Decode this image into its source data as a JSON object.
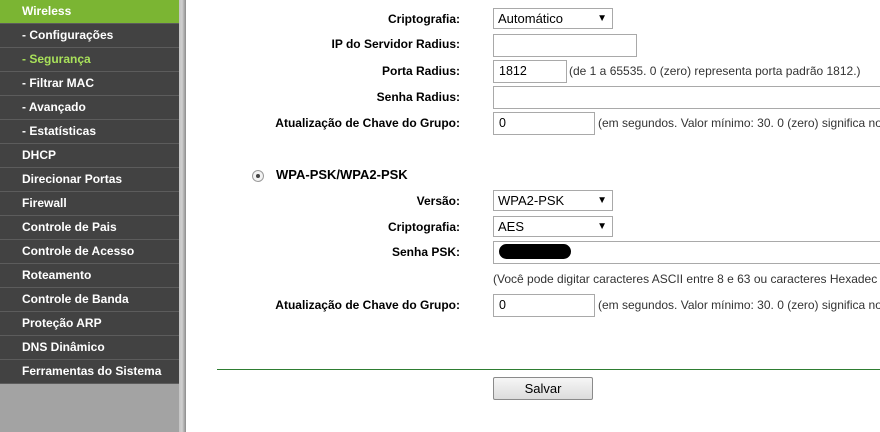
{
  "sidebar": {
    "items": [
      {
        "label": "Wireless",
        "state": "active-parent",
        "sub": false
      },
      {
        "label": "- Configurações",
        "state": "",
        "sub": true
      },
      {
        "label": "- Segurança",
        "state": "active",
        "sub": true
      },
      {
        "label": "- Filtrar MAC",
        "state": "",
        "sub": true
      },
      {
        "label": "- Avançado",
        "state": "",
        "sub": true
      },
      {
        "label": "- Estatísticas",
        "state": "",
        "sub": true
      },
      {
        "label": "DHCP",
        "state": "",
        "sub": false
      },
      {
        "label": "Direcionar Portas",
        "state": "",
        "sub": false
      },
      {
        "label": "Firewall",
        "state": "",
        "sub": false
      },
      {
        "label": "Controle de Pais",
        "state": "",
        "sub": false
      },
      {
        "label": "Controle de Acesso",
        "state": "",
        "sub": false
      },
      {
        "label": "Roteamento",
        "state": "",
        "sub": false
      },
      {
        "label": "Controle de Banda",
        "state": "",
        "sub": false
      },
      {
        "label": "Proteção ARP",
        "state": "",
        "sub": false
      },
      {
        "label": "DNS Dinâmico",
        "state": "",
        "sub": false
      },
      {
        "label": "Ferramentas do Sistema",
        "state": "",
        "sub": false
      }
    ]
  },
  "wpa_enterprise": {
    "crypto_label": "Criptografia:",
    "crypto_value": "Automático",
    "radius_ip_label": "IP do Servidor Radius:",
    "radius_ip_value": "",
    "radius_port_label": "Porta Radius:",
    "radius_port_value": "1812",
    "radius_port_hint": "(de 1 a 65535. 0 (zero) representa porta padrão 1812.)",
    "radius_password_label": "Senha Radius:",
    "radius_password_value": "",
    "group_key_label": "Atualização de Chave do Grupo:",
    "group_key_value": "0",
    "group_key_hint": "(em segundos. Valor mínimo: 30. 0 (zero) significa no"
  },
  "wpa_psk": {
    "title": "WPA-PSK/WPA2-PSK",
    "selected": true,
    "version_label": "Versão:",
    "version_value": "WPA2-PSK",
    "crypto_label": "Criptografia:",
    "crypto_value": "AES",
    "psk_label": "Senha PSK:",
    "psk_hint": "(Você pode digitar caracteres ASCII entre 8 e 63 ou caracteres Hexadec",
    "group_key_label": "Atualização de Chave do Grupo:",
    "group_key_value": "0",
    "group_key_hint": "(em segundos. Valor mínimo: 30. 0 (zero) significa no"
  },
  "footer": {
    "save_label": "Salvar"
  },
  "colors": {
    "accent_green": "#7bb533",
    "active_text": "#a8e05a",
    "nav_bg": "#424242",
    "divider": "#2e7d32"
  }
}
